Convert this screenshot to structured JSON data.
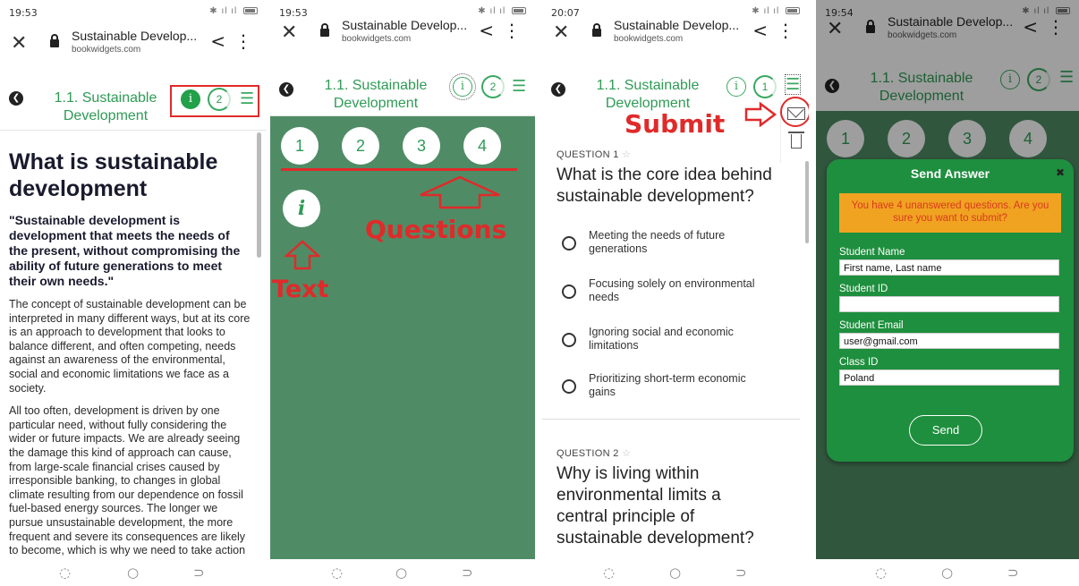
{
  "panels": [
    {
      "time": "19:53",
      "page_title": "Sustainable Develop...",
      "domain": "bookwidgets.com",
      "app_title": "1.1. Sustainable Development",
      "count": "2",
      "heading": "What is sustainable development",
      "quote": "\"Sustainable development is development that meets the needs of the present, without compromising the ability of future generations to meet their own needs.\"",
      "paragraph1": "The concept of sustainable development can be interpreted in many different ways, but at its core is an approach to development that looks to balance different, and often competing, needs against an awareness of the environmental, social and economic limitations we face as a society.",
      "paragraph2": "All too often, development is driven by one particular need, without fully considering the wider or future impacts. We are already seeing the damage this kind of approach can cause, from large-scale financial crises caused by irresponsible banking, to changes in global climate resulting from our dependence on fossil fuel-based energy sources. The longer we pursue unsustainable development, the more frequent and severe its consequences are likely to become, which is why we need to take action now."
    },
    {
      "time": "19:53",
      "page_title": "Sustainable Develop...",
      "domain": "bookwidgets.com",
      "app_title": "1.1. Sustainable Development",
      "count": "2",
      "question_numbers": [
        "1",
        "2",
        "3",
        "4"
      ],
      "info_label": "i",
      "annotation_questions": "Questions",
      "annotation_text": "Text"
    },
    {
      "time": "20:07",
      "page_title": "Sustainable Develop...",
      "domain": "bookwidgets.com",
      "app_title": "1.1. Sustainable Development",
      "count": "1",
      "annotation_submit": "Submit",
      "question1_label": "QUESTION 1",
      "question1_text": "What is the core idea behind sustainable development?",
      "options": [
        "Meeting the needs of future generations",
        "Focusing solely on environmental needs",
        "Ignoring social and economic limitations",
        "Prioritizing short-term economic gains"
      ],
      "question2_label": "QUESTION 2",
      "question2_text": "Why is living within environmental limits a central principle of sustainable development?"
    },
    {
      "time": "19:54",
      "page_title": "Sustainable Develop...",
      "domain": "bookwidgets.com",
      "app_title": "1.1. Sustainable Development",
      "count": "2",
      "question_numbers": [
        "1",
        "2",
        "3",
        "4"
      ],
      "dialog_title": "Send Answer",
      "warning": "You have 4 unanswered questions. Are you sure you want to submit?",
      "fields": [
        {
          "label": "Student Name",
          "value": "First name, Last name"
        },
        {
          "label": "Student ID",
          "value": ""
        },
        {
          "label": "Student Email",
          "value": "user@gmail.com"
        },
        {
          "label": "Class ID",
          "value": "Poland"
        }
      ],
      "send_label": "Send"
    }
  ],
  "colors": {
    "accent_green": "#2e9b55",
    "content_green": "#4f8c65",
    "dialog_green": "#1e8f3e",
    "annotation_red": "#e02a2a",
    "warning_orange": "#f0a321"
  },
  "icons": [
    "close-icon",
    "lock-icon",
    "share-icon",
    "more-icon",
    "back-icon",
    "info-icon",
    "menu-icon",
    "envelope-icon",
    "trash-icon",
    "star-icon",
    "recent-apps-icon",
    "home-icon",
    "back-nav-icon"
  ]
}
